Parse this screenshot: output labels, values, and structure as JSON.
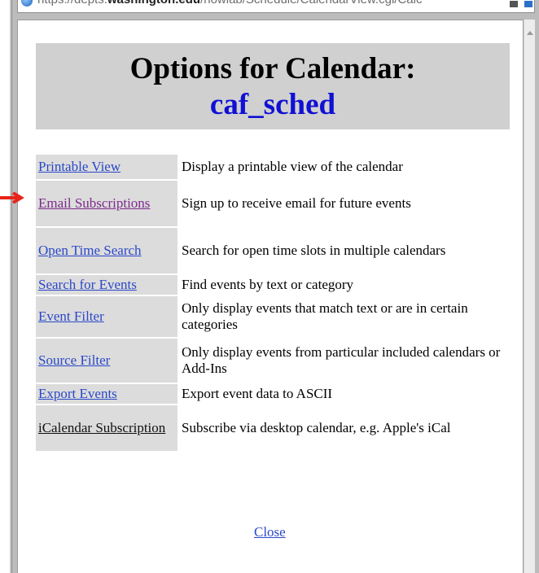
{
  "browser": {
    "url_prefix": "https://depts.",
    "url_domain": "washington.edu",
    "url_path": "/nowlab/Schedule/CalendarView.cgi/Calc"
  },
  "title": {
    "line1": "Options for Calendar:",
    "line2": "caf_sched"
  },
  "options": [
    {
      "link": "Printable View",
      "description": "Display a printable view of the calendar"
    },
    {
      "link": "Email Subscriptions",
      "description": "Sign up to receive email for future events"
    },
    {
      "link": "Open Time Search",
      "description": "Search for open time slots in multiple calendars"
    },
    {
      "link": "Search for Events",
      "description": "Find events by text or category"
    },
    {
      "link": "Event Filter",
      "description": "Only display events that match text or are in certain categories"
    },
    {
      "link": "Source Filter",
      "description": "Only display events from particular included calendars or Add-Ins"
    },
    {
      "link": "Export Events",
      "description": "Export event data to ASCII"
    },
    {
      "link": "iCalendar Subscription",
      "description": "Subscribe via desktop calendar, e.g. Apple's iCal"
    }
  ],
  "close_label": "Close",
  "colors": {
    "link": "#2a48c8",
    "visited_link": "#7d2a8c",
    "title_blue": "#1010d4",
    "arrow": "#e8231a"
  }
}
